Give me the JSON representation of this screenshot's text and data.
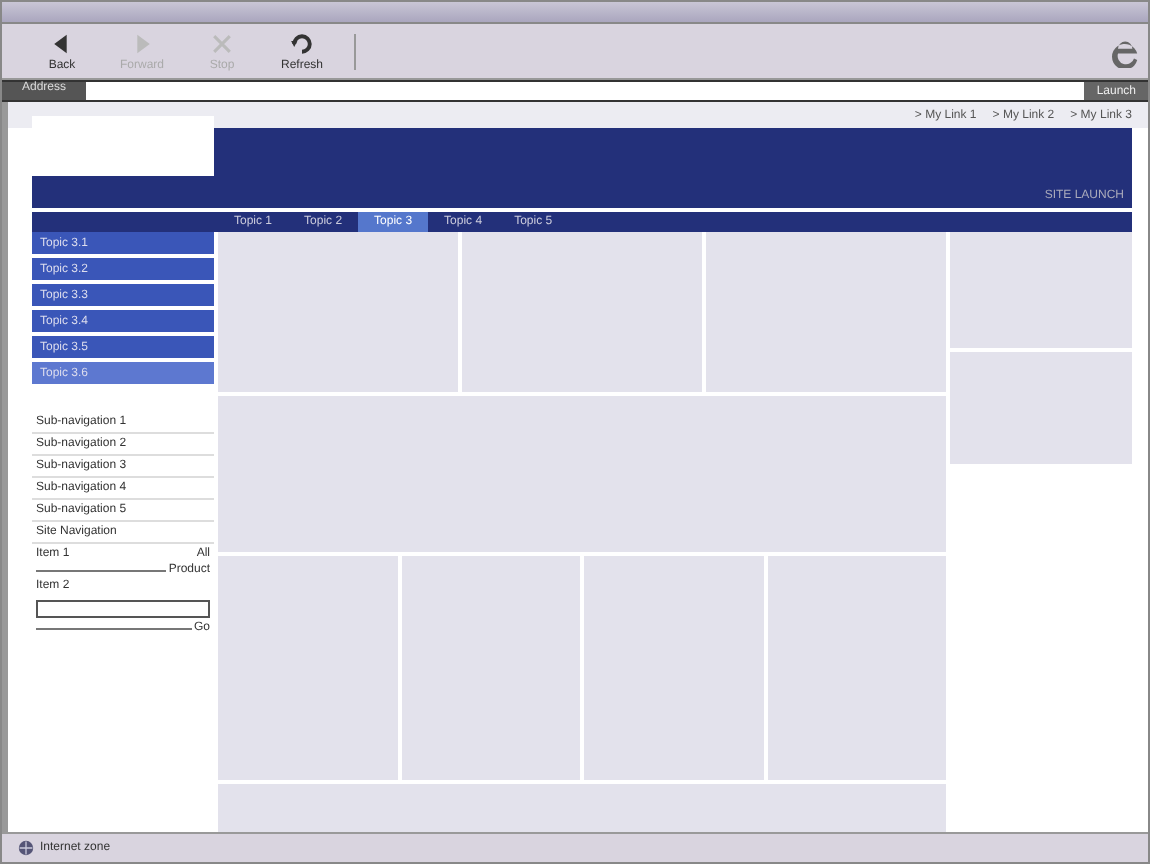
{
  "toolbar": {
    "buttons": [
      {
        "kind": "back",
        "label": "Back",
        "disabled": false
      },
      {
        "kind": "forward",
        "label": "Forward",
        "disabled": true
      },
      {
        "kind": "stop",
        "label": "Stop",
        "disabled": true
      },
      {
        "kind": "refresh",
        "label": "Refresh",
        "disabled": false
      }
    ]
  },
  "address_bar": {
    "label": "Address",
    "go": "Launch"
  },
  "page": {
    "links": [
      "> My Link 1",
      "> My Link 2",
      "> My Link 3"
    ],
    "banner_text": "SITE LAUNCH",
    "tabs": [
      {
        "label": "Topic 1",
        "selected": false
      },
      {
        "label": "Topic 2",
        "selected": false
      },
      {
        "label": "Topic 3",
        "selected": true
      },
      {
        "label": "Topic 4",
        "selected": false
      },
      {
        "label": "Topic 5",
        "selected": false
      }
    ],
    "subtopics": [
      {
        "label": "Topic 3.1",
        "selected": false
      },
      {
        "label": "Topic 3.2",
        "selected": false
      },
      {
        "label": "Topic 3.3",
        "selected": false
      },
      {
        "label": "Topic 3.4",
        "selected": false
      },
      {
        "label": "Topic 3.5",
        "selected": false
      },
      {
        "label": "Topic 3.6",
        "selected": true
      }
    ],
    "sub_navigation": [
      "Sub-navigation 1",
      "Sub-navigation 2",
      "Sub-navigation 3",
      "Sub-navigation 4",
      "Sub-navigation 5"
    ],
    "site_navigation": "Site Navigation",
    "item_1": {
      "label": "Item 1",
      "value": "All",
      "caption": "Product"
    },
    "item_2": {
      "label": "Item 2",
      "button": "Go"
    }
  },
  "status_bar": {
    "text": "Internet zone"
  }
}
